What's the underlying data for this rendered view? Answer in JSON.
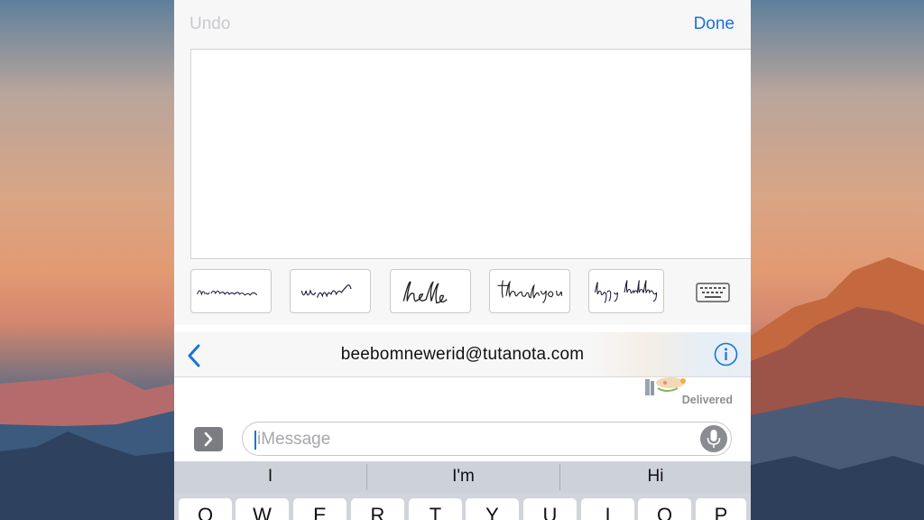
{
  "handwriting": {
    "undo_label": "Undo",
    "done_label": "Done",
    "suggestions": [
      "hello! how are you? -Tommy",
      "hey whatsup?",
      "hello",
      "thank you",
      "happy birthday"
    ]
  },
  "conversation": {
    "contact": "beebomnewerid@tutanota.com",
    "status": "Delivered"
  },
  "composer": {
    "placeholder": "iMessage",
    "value": ""
  },
  "keyboard": {
    "predictions": [
      "I",
      "I'm",
      "Hi"
    ],
    "row1": [
      "Q",
      "W",
      "E",
      "R",
      "T",
      "Y",
      "U",
      "I",
      "O",
      "P"
    ]
  },
  "colors": {
    "accent": "#1a73d9",
    "disabled": "#c9cacd"
  },
  "icons": [
    "back-chevron-icon",
    "info-icon",
    "keyboard-icon",
    "chevron-right-icon",
    "microphone-icon"
  ]
}
